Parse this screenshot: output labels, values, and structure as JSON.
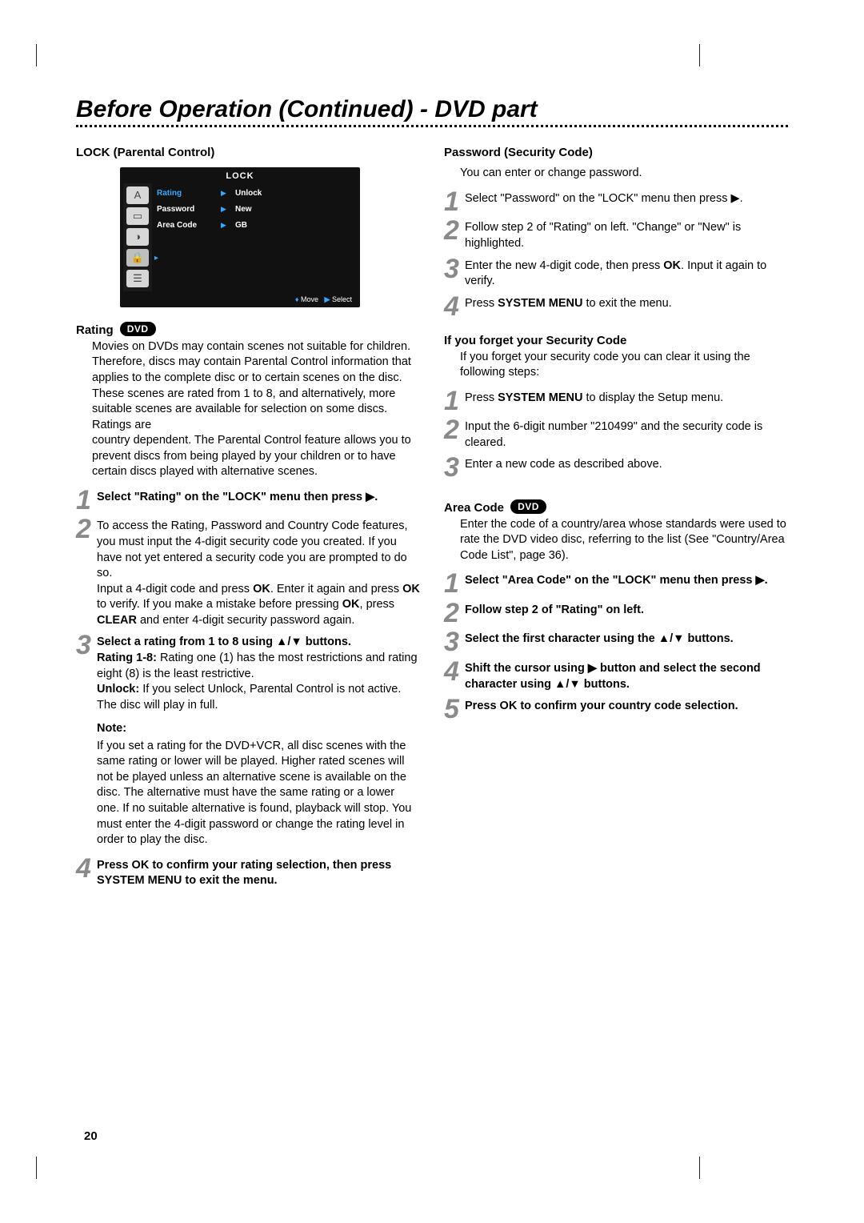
{
  "header": {
    "title": "Before Operation (Continued) - DVD part"
  },
  "page_number": "20",
  "left": {
    "lock_heading": "LOCK (Parental Control)",
    "screenshot": {
      "title": "LOCK",
      "rows": [
        {
          "label": "Rating",
          "value": "Unlock"
        },
        {
          "label": "Password",
          "value": "New"
        },
        {
          "label": "Area Code",
          "value": "GB"
        }
      ],
      "footer_move": "Move",
      "footer_select": "Select"
    },
    "rating_heading": "Rating",
    "rating_badge": "DVD",
    "rating_body": "Movies on DVDs may contain scenes not suitable for children. Therefore, discs may contain Parental Control information that applies to the complete disc or to certain scenes on the disc. These scenes are rated from 1 to 8, and alternatively, more suitable scenes are available for selection on some discs. Ratings are\ncountry dependent. The Parental Control feature allows you to prevent discs from being played by your children or to have certain discs played with alternative scenes.",
    "steps": [
      {
        "n": "1",
        "lead": "Select \"Rating\" on the \"LOCK\" menu then press ▶.",
        "body": ""
      },
      {
        "n": "2",
        "lead": "",
        "body_pre": "To access the Rating, Password and Country Code features, you must input the 4-digit security code you created. If you have not yet entered a security code you are prompted to do so.",
        "body_post": "Input a 4-digit code and press OK. Enter it again and press OK to verify. If you make a mistake before pressing OK, press CLEAR and enter 4-digit security password again."
      },
      {
        "n": "3",
        "lead": "Select a rating from 1 to 8 using ▲/▼ buttons.",
        "body_r18": "Rating 1-8: Rating one (1) has the most restrictions and rating eight (8) is the least restrictive.",
        "body_unlock": "Unlock: If you select Unlock, Parental Control is not active. The disc will play in full."
      },
      {
        "n": "4",
        "lead": "Press OK to confirm your rating selection, then press SYSTEM MENU to exit the menu.",
        "body": ""
      }
    ],
    "note_heading": "Note:",
    "note_body": "If you set a rating for the DVD+VCR, all disc scenes with the same rating or lower will be played. Higher rated scenes will not be played unless an alternative scene is available on the disc. The alternative must have the same rating or a lower one. If no suitable alternative is found, playback will stop. You must enter the 4-digit password or change the rating level in order to play the disc."
  },
  "right": {
    "password_heading": "Password (Security Code)",
    "password_intro": "You can enter or change password.",
    "password_steps": [
      {
        "n": "1",
        "body": "Select \"Password\" on the \"LOCK\" menu then press ▶."
      },
      {
        "n": "2",
        "body": "Follow step 2 of \"Rating\" on left. \"Change\" or \"New\" is highlighted."
      },
      {
        "n": "3",
        "body": "Enter the new 4-digit code, then press OK. Input it again to verify."
      },
      {
        "n": "4",
        "body": "Press SYSTEM MENU to exit the menu."
      }
    ],
    "forget_heading": "If you forget your Security Code",
    "forget_intro": "If you forget your security code you can clear it using the following steps:",
    "forget_steps": [
      {
        "n": "1",
        "body": "Press SYSTEM MENU to display the Setup menu."
      },
      {
        "n": "2",
        "body": "Input the 6-digit number \"210499\" and the security code is cleared."
      },
      {
        "n": "3",
        "body": "Enter a new code as described above."
      }
    ],
    "area_heading": "Area Code",
    "area_badge": "DVD",
    "area_intro": "Enter the code of a country/area whose standards were used to rate the DVD video disc, referring to the list (See \"Country/Area Code List\", page 36).",
    "area_steps": [
      {
        "n": "1",
        "lead": "Select \"Area Code\" on the \"LOCK\" menu then press ▶."
      },
      {
        "n": "2",
        "lead": "Follow step 2 of \"Rating\" on left."
      },
      {
        "n": "3",
        "lead": "Select the first character using the ▲/▼ buttons."
      },
      {
        "n": "4",
        "lead": "Shift the cursor using ▶ button and select the second character using ▲/▼ buttons."
      },
      {
        "n": "5",
        "lead": "Press OK to confirm your country code selection."
      }
    ]
  }
}
